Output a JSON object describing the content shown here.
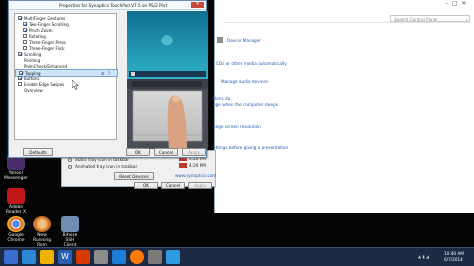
{
  "desktop": {
    "icons": [
      {
        "label_1": "Yahoo!",
        "label_2": "Messenger",
        "color": "#4a2d6b"
      },
      {
        "label_1": "Adobe",
        "label_2": "Reader X",
        "color": "#c01818"
      },
      {
        "label_1": "Google",
        "label_2": "Chrome",
        "color": "#dd4b39"
      },
      {
        "label_1": "New Running",
        "label_2": "Rom",
        "color": "#c86b20"
      },
      {
        "label_1": "Bitvise SSH",
        "label_2": "Client",
        "color": "#6f8fb0"
      }
    ]
  },
  "control_panel": {
    "search_placeholder": "Search Control Panel",
    "links": [
      "Device Manager",
      "r CDs or other media automatically",
      "Manage audio devices",
      "ttons do",
      "nge when the computer sleeps",
      "ange screen resolution",
      "ettings before giving a presentation"
    ]
  },
  "dialog": {
    "title": "Properties for Synaptics TouchPad V7.5 on PS/2 Port",
    "tree_items": [
      {
        "label": "MultiFinger Gestures",
        "checked": true,
        "indent": 0
      },
      {
        "label": "Two-Finger Scrolling",
        "checked": true,
        "indent": 1
      },
      {
        "label": "Pinch Zoom",
        "checked": true,
        "indent": 1
      },
      {
        "label": "Rotating",
        "checked": false,
        "indent": 1
      },
      {
        "label": "Three-Finger Press",
        "checked": false,
        "indent": 1
      },
      {
        "label": "Three-Finger Flick",
        "checked": false,
        "indent": 1
      },
      {
        "label": "Scrolling",
        "checked": true,
        "indent": 0
      },
      {
        "label": "Pointing",
        "checked": null,
        "indent": 0
      },
      {
        "label": "PalmCheck/Enhanced",
        "checked": null,
        "indent": 0
      },
      {
        "label": "Tapping",
        "checked": true,
        "indent": 0,
        "selected": true
      },
      {
        "label": "Buttons",
        "checked": true,
        "indent": 0
      },
      {
        "label": "Enable Edge Swipes",
        "checked": false,
        "indent": 0
      },
      {
        "label": "Overview",
        "checked": null,
        "indent": 0
      }
    ],
    "defaults_label": "Defaults",
    "ok_label": "OK",
    "cancel_label": "Cancel",
    "apply_label": "Apply"
  },
  "dialog2": {
    "static_tray_label": "Static tray icon in taskbar",
    "animated_tray_label": "Animated tray icon in taskbar",
    "reset_label": "Reset Devices",
    "link": "www.synaptics.com",
    "ok_label": "OK",
    "cancel_label": "Cancel",
    "apply_label": "Apply",
    "time_1": "4:20 PM",
    "time_2": "4:20 PM"
  },
  "taskbar": {
    "time": "10:40 AM",
    "date": "6/7/2014",
    "apps": [
      "#3b6ccf",
      "#2d86d8",
      "#f0b400",
      "#2a5fb0",
      "#d83b01",
      "#8d8d8d",
      "#1d7dd6",
      "#ff7a00",
      "#7a7a7a",
      "#2e9be0"
    ]
  }
}
